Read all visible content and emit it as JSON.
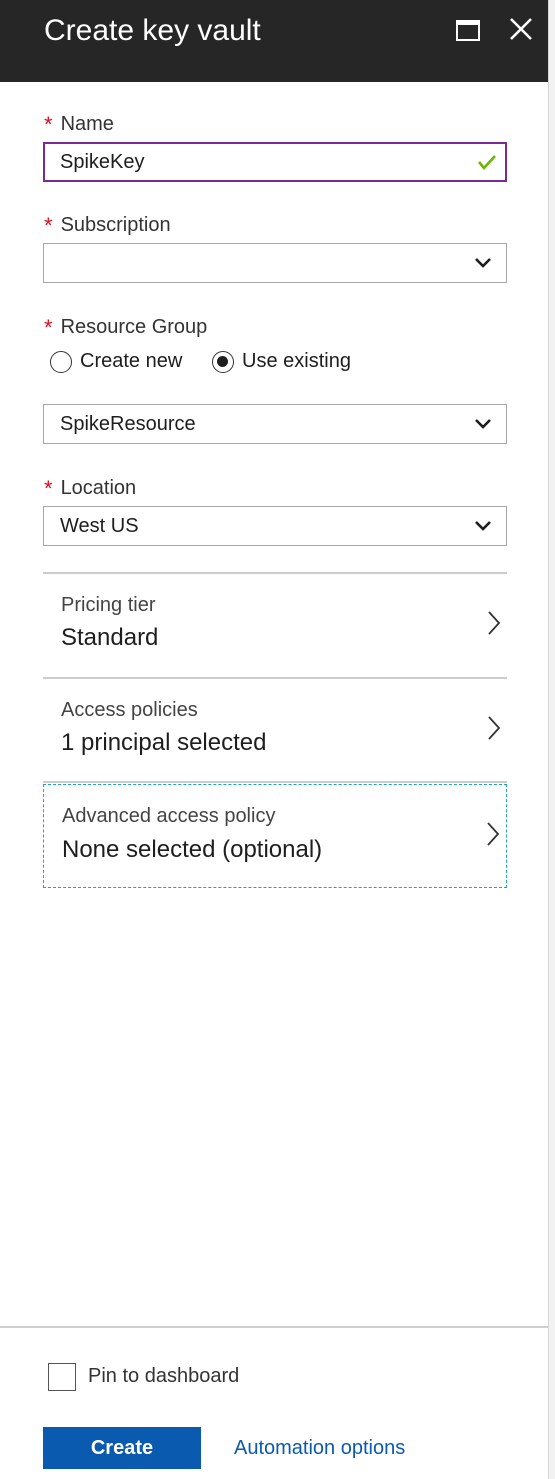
{
  "header": {
    "title": "Create key vault"
  },
  "form": {
    "required_marker": "*",
    "name": {
      "label": "Name",
      "value": "SpikeKey"
    },
    "subscription": {
      "label": "Subscription",
      "value": ""
    },
    "resource_group": {
      "label": "Resource Group",
      "options": [
        "Create new",
        "Use existing"
      ],
      "selected": "Use existing",
      "value": "SpikeResource"
    },
    "location": {
      "label": "Location",
      "value": "West US"
    }
  },
  "nav_items": [
    {
      "title": "Pricing tier",
      "value": "Standard"
    },
    {
      "title": "Access policies",
      "value": "1 principal selected"
    },
    {
      "title": "Advanced access policy",
      "value": "None selected (optional)"
    }
  ],
  "footer": {
    "pin_label": "Pin to dashboard",
    "create_label": "Create",
    "automation_label": "Automation options"
  },
  "colors": {
    "header_bg": "#262626",
    "required": "#e00b1c",
    "valid_check": "#6bb700",
    "active_border": "#7a2a94",
    "primary": "#0a5bb0",
    "focus_dashed": "#1fa5b5"
  }
}
